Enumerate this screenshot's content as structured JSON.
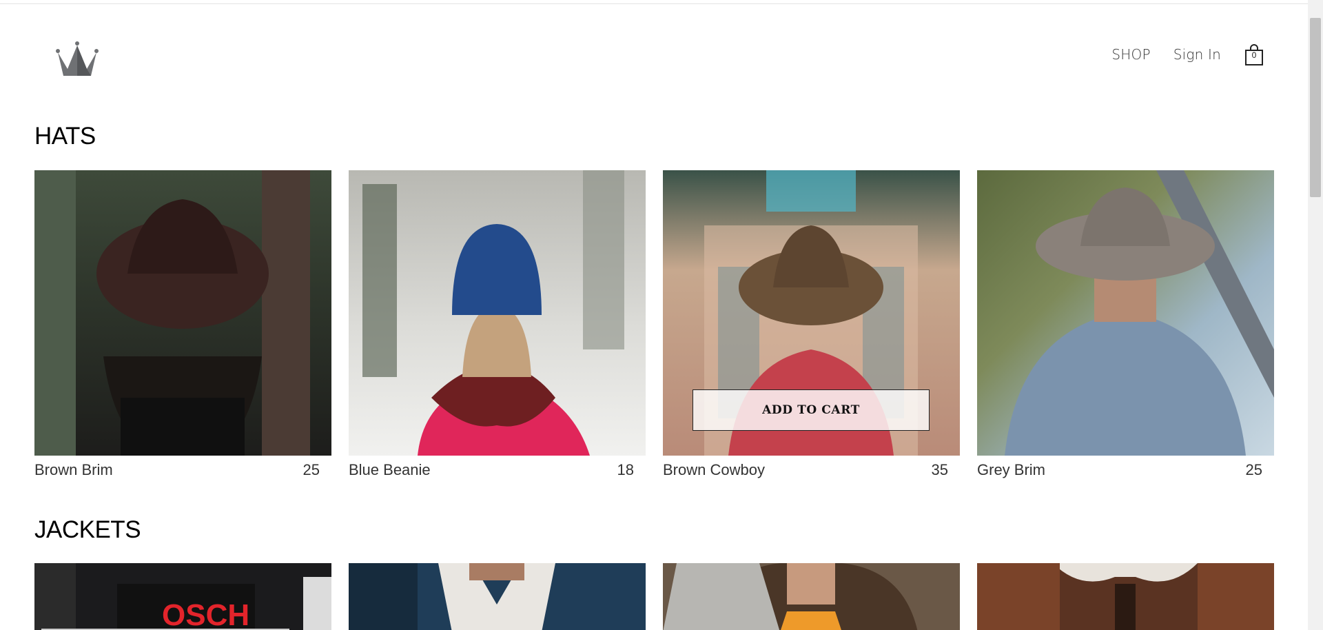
{
  "header": {
    "logo_icon": "crown-icon",
    "nav": {
      "shop": "SHOP",
      "sign_in": "Sign In"
    },
    "cart": {
      "icon": "shopping-bag-icon",
      "count": "0"
    }
  },
  "sections": [
    {
      "title": "HATS",
      "items": [
        {
          "name": "Brown Brim",
          "price": "25"
        },
        {
          "name": "Blue Beanie",
          "price": "18"
        },
        {
          "name": "Brown Cowboy",
          "price": "35",
          "hover_button": "ADD TO CART"
        },
        {
          "name": "Grey Brim",
          "price": "25"
        }
      ]
    },
    {
      "title": "JACKETS",
      "items": [
        {
          "name": "",
          "price": ""
        },
        {
          "name": "",
          "price": ""
        },
        {
          "name": "",
          "price": ""
        },
        {
          "name": "",
          "price": ""
        }
      ]
    }
  ]
}
